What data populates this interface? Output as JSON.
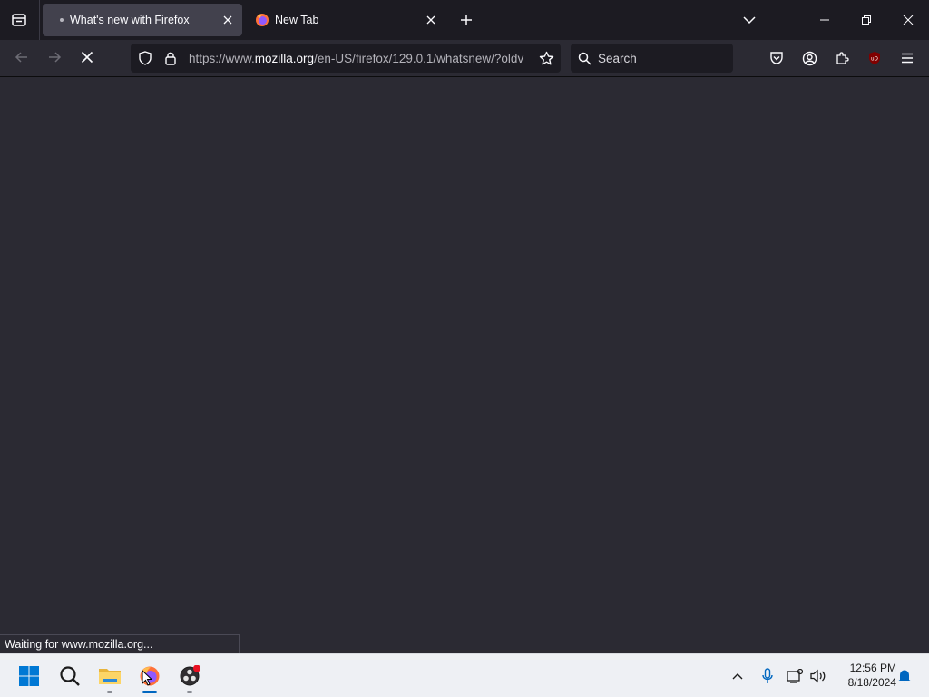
{
  "browser": {
    "tabs": [
      {
        "title": "What's new with Firefox",
        "active": true,
        "loading": true
      },
      {
        "title": "New Tab",
        "active": false,
        "loading": false
      }
    ],
    "url": {
      "prefix": "https://www.",
      "host": "mozilla.org",
      "path": "/en-US/firefox/129.0.1/whatsnew/?oldv"
    },
    "search_placeholder": "Search",
    "status_text": "Waiting for www.mozilla.org...",
    "extension_badge": "uD"
  },
  "taskbar": {
    "time": "12:56 PM",
    "date": "8/18/2024",
    "apps": [
      "start-icon",
      "search-icon",
      "file-explorer-icon",
      "firefox-icon",
      "obs-icon"
    ]
  },
  "colors": {
    "toolbar_bg": "#2b2a33",
    "tabstrip_bg": "#1c1b22",
    "active_tab_bg": "#42414d",
    "taskbar_bg": "#eef0f4",
    "accent": "#0067c0"
  }
}
